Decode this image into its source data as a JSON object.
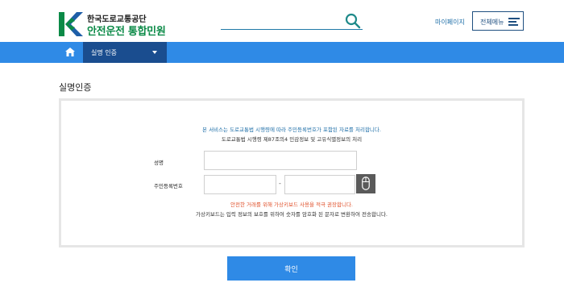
{
  "header": {
    "org_name": "한국도로교통공단",
    "service_name": "안전운전 통합민원",
    "mypage_label": "마이페이지",
    "allmenu_label": "전체메뉴"
  },
  "nav": {
    "current_label": "실명 인증"
  },
  "page": {
    "title": "실명인증"
  },
  "panel": {
    "notice_line1": "본 서비스는 도로교통법 시행령에 따라 주민등록번호가 포함된 자료를 처리합니다.",
    "notice_line2": "도로교통법 시행령 제87조의4 민감정보 및 고유식별정보의 처리",
    "name_label": "성명",
    "rrn_label": "주민등록번호",
    "rrn_separator": "-",
    "warning": "안전한 거래를 위해 가상키보드 사용을 적극 권장합니다.",
    "info": "가상키보드는 입력 정보의 보호를 위하여 숫자를 암호화 된 문자로 변환하여 전송합니다."
  },
  "confirm_label": "확인",
  "colors": {
    "accent": "#2f8ae6",
    "nav_dark": "#1a4d8f",
    "brand_green": "#0b8a47",
    "warning": "#e0522c"
  },
  "icons": [
    "kotsa-logo",
    "search-icon",
    "hamburger-icon",
    "home-icon",
    "caret-down-icon",
    "mouse-icon"
  ]
}
